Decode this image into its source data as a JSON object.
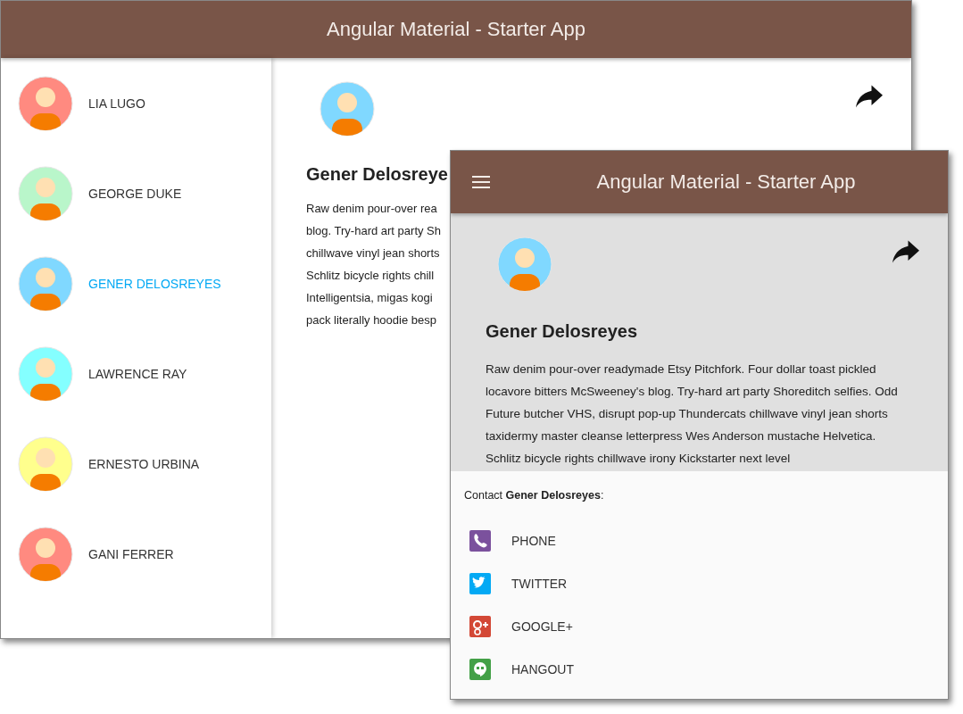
{
  "back_window": {
    "title": "Angular Material - Starter App",
    "sidebar": {
      "items": [
        {
          "name": "LIA LUGO",
          "selected": false,
          "color": "#ff8a80"
        },
        {
          "name": "GEORGE DUKE",
          "selected": false,
          "color": "#b9f6ca"
        },
        {
          "name": "GENER DELOSREYES",
          "selected": true,
          "color": "#80d8ff"
        },
        {
          "name": "LAWRENCE RAY",
          "selected": false,
          "color": "#84ffff"
        },
        {
          "name": "ERNESTO URBINA",
          "selected": false,
          "color": "#ffff8d"
        },
        {
          "name": "GANI FERRER",
          "selected": false,
          "color": "#ff8a80"
        }
      ]
    },
    "detail": {
      "avatar": {
        "color": "#80d8ff"
      },
      "name": "Gener Delosreye",
      "lines": [
        "Raw denim pour-over rea",
        "blog. Try-hard art party Sh",
        "chillwave vinyl jean shorts",
        "Schlitz bicycle rights chill",
        "Intelligentsia, migas kogi",
        "pack literally hoodie besp"
      ]
    }
  },
  "front_window": {
    "title": "Angular Material - Starter App",
    "detail": {
      "avatar": {
        "color": "#80d8ff"
      },
      "name": "Gener Delosreyes",
      "text": "Raw denim pour-over readymade Etsy Pitchfork. Four dollar toast pickled locavore bitters McSweeney's blog. Try-hard art party Shoreditch selfies. Odd Future butcher VHS, disrupt pop-up Thundercats chillwave vinyl jean shorts taxidermy master cleanse letterpress Wes Anderson mustache Helvetica. Schlitz bicycle rights chillwave irony Kickstarter next level"
    },
    "contact": {
      "label": "Contact **Gener Delosreyes**:",
      "items": [
        {
          "kind": "phone",
          "label": "PHONE"
        },
        {
          "kind": "twitter",
          "label": "TWITTER"
        },
        {
          "kind": "googleplus",
          "label": "GOOGLE+"
        },
        {
          "kind": "hangout",
          "label": "HANGOUT"
        }
      ]
    }
  }
}
